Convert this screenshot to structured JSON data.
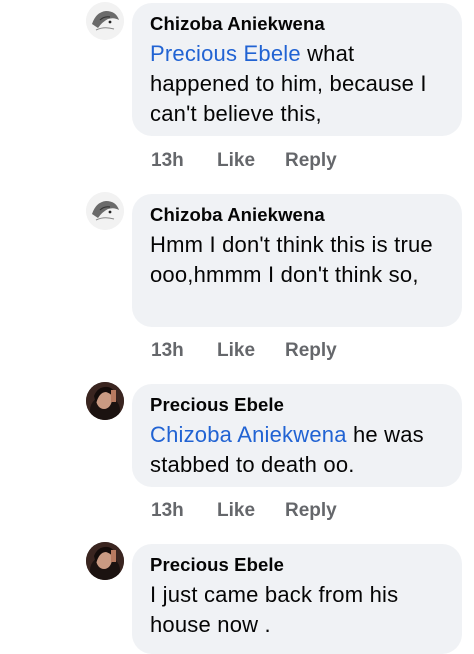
{
  "comments": [
    {
      "author": "Chizoba Aniekwena",
      "mention": "Precious Ebele",
      "text": " what happened to him, because I can't believe this,",
      "time": "13h",
      "like": "Like",
      "reply": "Reply",
      "avatar": "sketch-avatar"
    },
    {
      "author": "Chizoba Aniekwena",
      "mention": "",
      "text": "Hmm I don't think this is true ooo,hmmm I don't think so,",
      "time": "13h",
      "like": "Like",
      "reply": "Reply",
      "avatar": "sketch-avatar"
    },
    {
      "author": "Precious Ebele",
      "mention": "Chizoba Aniekwena",
      "text": " he was stabbed to death oo.",
      "time": "13h",
      "like": "Like",
      "reply": "Reply",
      "avatar": "photo-avatar"
    },
    {
      "author": "Precious Ebele",
      "mention": "",
      "text": "I just came back from his house now .",
      "avatar": "photo-avatar"
    }
  ],
  "colors": {
    "bubble": "#f0f2f5",
    "mention": "#2163d3",
    "meta": "#65676b",
    "author": "#050505"
  }
}
